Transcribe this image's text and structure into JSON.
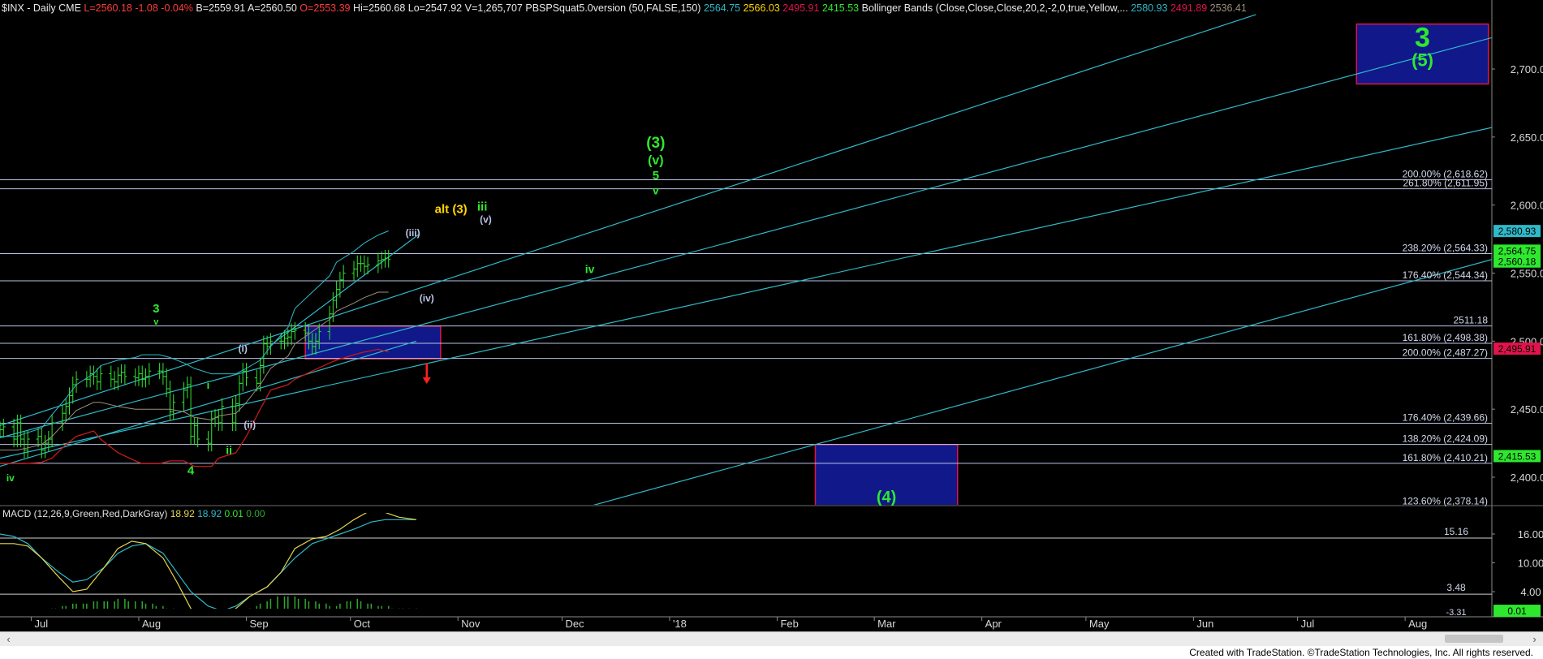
{
  "header": {
    "symbol": "$INX - Daily",
    "exchange": "CME",
    "last": "L=2560.18",
    "change": "-1.08",
    "change_pct": "-0.04%",
    "bid": "B=2559.91",
    "ask": "A=2560.50",
    "open": "O=2553.39",
    "high": "Hi=2560.68",
    "low": "Lo=2547.92",
    "volume": "V=1,265,707",
    "study1_name": "PBSPSquat5.0version (50,FALSE,150)",
    "study1_values": [
      "2564.75",
      "2566.03",
      "2495.91",
      "2415.53"
    ],
    "study2_name": "Bollinger Bands (Close,Close,Close,20,2,-2,0,true,Yellow,...",
    "study2_values": [
      "2580.93",
      "2491.89",
      "2536.41"
    ]
  },
  "colors": {
    "background": "#000000",
    "channel": "#2fb9c9",
    "fib_line": "#b9c4e6",
    "wave_green": "#2ee82e",
    "alt_yellow": "#ffd700",
    "box_fill": "#10188a",
    "box_border": "#e0144c",
    "bb_lower": "#c41a1a",
    "macd_line": "#e3d64b",
    "macd_signal": "#2fb9c9",
    "hist_pos": "#2ea82e",
    "hist_neg": "#c41a1a",
    "down_arrow": "#ff2020"
  },
  "chart_data": [
    {
      "type": "ohlc",
      "id": "price-panel",
      "title": "$INX - Daily",
      "ylim": [
        2378,
        2740
      ],
      "y_ticks": [
        2400,
        2450,
        2500,
        2550,
        2600,
        2650,
        2700
      ],
      "y_tick_labels": [
        "2,400.00",
        "2,450.00",
        "2,500.00",
        "2,550.00",
        "2,600.00",
        "2,650.00",
        "2,700.00"
      ],
      "x_ticks": [
        {
          "date": "2017-07-01",
          "label": "Jul"
        },
        {
          "date": "2017-08-01",
          "label": "Aug"
        },
        {
          "date": "2017-09-01",
          "label": "Sep"
        },
        {
          "date": "2017-10-01",
          "label": "Oct"
        },
        {
          "date": "2017-11-01",
          "label": "Nov"
        },
        {
          "date": "2017-12-01",
          "label": "Dec"
        },
        {
          "date": "2018-01-01",
          "label": "'18"
        },
        {
          "date": "2018-02-01",
          "label": "Feb"
        },
        {
          "date": "2018-03-01",
          "label": "Mar"
        },
        {
          "date": "2018-04-01",
          "label": "Apr"
        },
        {
          "date": "2018-05-01",
          "label": "May"
        },
        {
          "date": "2018-06-01",
          "label": "Jun"
        },
        {
          "date": "2018-07-01",
          "label": "Jul"
        },
        {
          "date": "2018-08-01",
          "label": "Aug"
        }
      ],
      "xlim": [
        "2017-06-22",
        "2018-08-26"
      ],
      "price_series": {
        "name": "$INX",
        "close": [
          2435,
          2437,
          2428,
          2440,
          2428,
          2420,
          2428,
          2430,
          2420,
          2425,
          2428,
          2440,
          2447,
          2452,
          2460,
          2468,
          2472,
          2472,
          2476,
          2474,
          2470,
          2476,
          2472,
          2470,
          2475,
          2477,
          2474,
          2473,
          2476,
          2472,
          2474,
          2478,
          2478,
          2474,
          2465,
          2448,
          2455,
          2464,
          2468,
          2430,
          2438,
          2428,
          2425,
          2443,
          2444,
          2440,
          2452,
          2440,
          2454,
          2469,
          2478,
          2473,
          2469,
          2482,
          2498,
          2496,
          2500,
          2500,
          2502,
          2503,
          2507,
          2508,
          2506,
          2500,
          2496,
          2500,
          2507,
          2520,
          2530,
          2538,
          2545,
          2550,
          2553,
          2557,
          2557,
          2555,
          2556,
          2559,
          2560,
          2561,
          2560
        ]
      },
      "bollinger_upper": [
        2430,
        2430,
        2432,
        2436,
        2446,
        2458,
        2468,
        2476,
        2482,
        2486,
        2488,
        2490,
        2490,
        2488,
        2484,
        2480,
        2476,
        2476,
        2476,
        2480,
        2486,
        2496,
        2510,
        2524,
        2536,
        2548,
        2558,
        2566,
        2572,
        2578,
        2581
      ],
      "bollinger_lower": [
        2410,
        2410,
        2410,
        2411,
        2414,
        2424,
        2430,
        2434,
        2428,
        2418,
        2412,
        2410,
        2410,
        2412,
        2412,
        2408,
        2408,
        2414,
        2418,
        2430,
        2450,
        2464,
        2468,
        2472,
        2478,
        2484,
        2486,
        2490,
        2492,
        2494,
        2492
      ],
      "bollinger_mid": [
        2420,
        2420,
        2421,
        2424,
        2430,
        2441,
        2449,
        2455,
        2455,
        2452,
        2450,
        2450,
        2450,
        2450,
        2448,
        2444,
        2442,
        2445,
        2447,
        2455,
        2468,
        2480,
        2489,
        2498,
        2507,
        2516,
        2522,
        2528,
        2532,
        2536,
        2536
      ],
      "channel_lines": [
        {
          "from": [
            "2017-06-22",
            2438
          ],
          "to": [
            "2018-06-19",
            2740
          ]
        },
        {
          "from": [
            "2017-06-22",
            2429
          ],
          "to": [
            "2018-08-26",
            2723
          ]
        },
        {
          "from": [
            "2017-06-22",
            2414
          ],
          "to": [
            "2018-08-26",
            2657
          ]
        },
        {
          "from": [
            "2017-06-22",
            2408
          ],
          "to": [
            "2017-10-20",
            2500
          ]
        },
        {
          "from": [
            "2017-09-08",
            2497
          ],
          "to": [
            "2017-10-21",
            2579
          ]
        },
        {
          "from": [
            "2017-12-08",
            2378
          ],
          "to": [
            "2018-08-26",
            2560
          ]
        }
      ],
      "fib_levels": [
        {
          "label": "200.00% (2,618.62)",
          "value": 2618.62
        },
        {
          "label": "261.80% (2,611.95)",
          "value": 2611.95
        },
        {
          "label": "238.20% (2,564.33)",
          "value": 2564.33
        },
        {
          "label": "176.40% (2,544.34)",
          "value": 2544.34
        },
        {
          "label": "2511.18",
          "value": 2511.18
        },
        {
          "label": "161.80% (2,498.38)",
          "value": 2498.38
        },
        {
          "label": "200.00% (2,487.27)",
          "value": 2487.27
        },
        {
          "label": "176.40% (2,439.66)",
          "value": 2439.66
        },
        {
          "label": "138.20% (2,424.09)",
          "value": 2424.09
        },
        {
          "label": "161.80% (2,410.21)",
          "value": 2410.21
        },
        {
          "label": "123.60% (2,378.14)",
          "value": 2378.14
        }
      ],
      "target_boxes": [
        {
          "from": "2018-07-18",
          "to": "2018-08-25",
          "high": 2733,
          "low": 2689,
          "label_top": "3",
          "label_bottom": "(5)"
        },
        {
          "from": "2017-09-18",
          "to": "2017-10-27",
          "high": 2511,
          "low": 2487
        },
        {
          "from": "2018-02-12",
          "to": "2018-03-25",
          "high": 2424,
          "low": 2378,
          "label_bottom": "(4)"
        }
      ],
      "price_badges": [
        {
          "text": "2,580.93",
          "value": 2580.93,
          "bg": "#2fb9c9",
          "fg": "#000000"
        },
        {
          "text": "2,564.75",
          "value": 2566.5,
          "bg": "#2ee82e",
          "fg": "#000000"
        },
        {
          "text": "2,560.18",
          "value": 2558.5,
          "bg": "#2ee82e",
          "fg": "#000000"
        },
        {
          "text": "2,495.91",
          "value": 2494.5,
          "bg": "#e0144c",
          "fg": "#000000"
        },
        {
          "text": "2,415.53",
          "value": 2415.53,
          "bg": "#2ee82e",
          "fg": "#000000"
        }
      ],
      "wave_labels": [
        {
          "text": "(3)",
          "date": "2017-12-28",
          "value": 2642,
          "color": "#2ee82e",
          "size": 19
        },
        {
          "text": "(v)",
          "date": "2017-12-28",
          "value": 2630,
          "color": "#2ee82e",
          "size": 16
        },
        {
          "text": "5",
          "date": "2017-12-28",
          "value": 2619,
          "color": "#2ee82e",
          "size": 15
        },
        {
          "text": "v",
          "date": "2017-12-28",
          "value": 2608,
          "color": "#2ee82e",
          "size": 14
        },
        {
          "text": "alt (3)",
          "date": "2017-10-30",
          "value": 2594,
          "color": "#ffd700",
          "size": 15
        },
        {
          "text": "iii",
          "date": "2017-11-08",
          "value": 2596,
          "color": "#2ee82e",
          "size": 15
        },
        {
          "text": "(v)",
          "date": "2017-11-09",
          "value": 2587,
          "color": "#b9c4e6",
          "size": 12
        },
        {
          "text": "(iii)",
          "date": "2017-10-19",
          "value": 2577,
          "color": "#b9c4e6",
          "size": 12
        },
        {
          "text": "iv",
          "date": "2017-12-09",
          "value": 2550,
          "color": "#2ee82e",
          "size": 14
        },
        {
          "text": "(iv)",
          "date": "2017-10-23",
          "value": 2529,
          "color": "#b9c4e6",
          "size": 12
        },
        {
          "text": "3",
          "date": "2017-08-06",
          "value": 2521,
          "color": "#2ee82e",
          "size": 15
        },
        {
          "text": "v",
          "date": "2017-08-06",
          "value": 2512,
          "color": "#2ee82e",
          "size": 11
        },
        {
          "text": "(i)",
          "date": "2017-08-31",
          "value": 2492,
          "color": "#b9c4e6",
          "size": 12
        },
        {
          "text": "i",
          "date": "2017-08-21",
          "value": 2465,
          "color": "#2ee82e",
          "size": 13
        },
        {
          "text": "(ii)",
          "date": "2017-09-02",
          "value": 2436,
          "color": "#b9c4e6",
          "size": 12
        },
        {
          "text": "ii",
          "date": "2017-08-27",
          "value": 2417,
          "color": "#2ee82e",
          "size": 14
        },
        {
          "text": "4",
          "date": "2017-08-16",
          "value": 2402,
          "color": "#2ee82e",
          "size": 15
        },
        {
          "text": "iv",
          "date": "2017-06-25",
          "value": 2397,
          "color": "#2ee82e",
          "size": 12
        }
      ],
      "arrow": {
        "date": "2017-10-23",
        "from_value": 2484,
        "to_value": 2471
      }
    },
    {
      "type": "line",
      "id": "macd-panel",
      "title": "MACD (12,26,9,Green,Red,DarkGray)",
      "legend_values": [
        "18.92",
        "18.92",
        "0.01",
        "0.00"
      ],
      "ylim": [
        -3,
        23
      ],
      "y_ticks": [
        16,
        10,
        4
      ],
      "y_tick_labels": [
        "16.00",
        "10.00",
        "4.00"
      ],
      "reference_levels": [
        {
          "label": "15.16",
          "value": 15.16
        },
        {
          "label": "3.48",
          "value": 3.48
        }
      ],
      "badge": {
        "text": "0.01",
        "value": 0.01,
        "bg": "#2ee82e",
        "fg": "#000000"
      },
      "series": [
        {
          "name": "MACD",
          "values": [
            14,
            14,
            13.5,
            11,
            7,
            4,
            4.5,
            9,
            13,
            14.5,
            14,
            11,
            6,
            0.5,
            -2.5,
            -1.5,
            0.5,
            3,
            5,
            8,
            13,
            15,
            15.5,
            17,
            19,
            21,
            20.5,
            19.5,
            19
          ]
        },
        {
          "name": "Signal",
          "values": [
            16,
            15.5,
            14,
            11,
            8,
            6,
            6.5,
            9,
            12,
            13.5,
            14,
            12,
            8,
            4,
            1,
            0,
            1,
            3,
            5,
            8,
            11,
            14,
            15,
            16,
            17,
            18.5,
            19,
            19,
            19
          ]
        }
      ],
      "histogram": [
        -2,
        -2,
        -2,
        -2,
        -1.5,
        -1,
        -1,
        -0.5,
        -0.5,
        -1,
        0.5,
        0.5,
        1,
        1,
        1.5,
        1.5,
        1.5,
        1.5,
        2,
        2,
        2,
        2,
        2,
        2.5,
        2.5,
        2,
        2,
        2,
        1.5,
        1.5,
        1,
        1,
        0.5,
        0.5,
        -0.5,
        -1,
        -1,
        -1.5,
        -2,
        -2,
        -2.5,
        -3,
        -3,
        -2.5,
        -2,
        -1.5,
        -1,
        -0.5,
        0.5,
        1,
        1.5,
        2,
        2.5,
        3,
        3,
        3,
        3,
        2.5,
        2.5,
        2,
        2,
        1.5,
        1.5,
        1,
        1,
        1.5,
        2,
        2,
        2.5,
        2,
        1.5,
        1.5,
        1,
        1,
        1,
        0.5,
        0.5,
        0.5,
        0.5,
        0.5
      ],
      "partial_tick_label": "-3.31"
    }
  ],
  "scrollbar": {
    "left_arrow": "‹",
    "right_arrow": "›"
  },
  "footer": {
    "credit": "Created with TradeStation. ©TradeStation Technologies, Inc. All rights reserved."
  }
}
